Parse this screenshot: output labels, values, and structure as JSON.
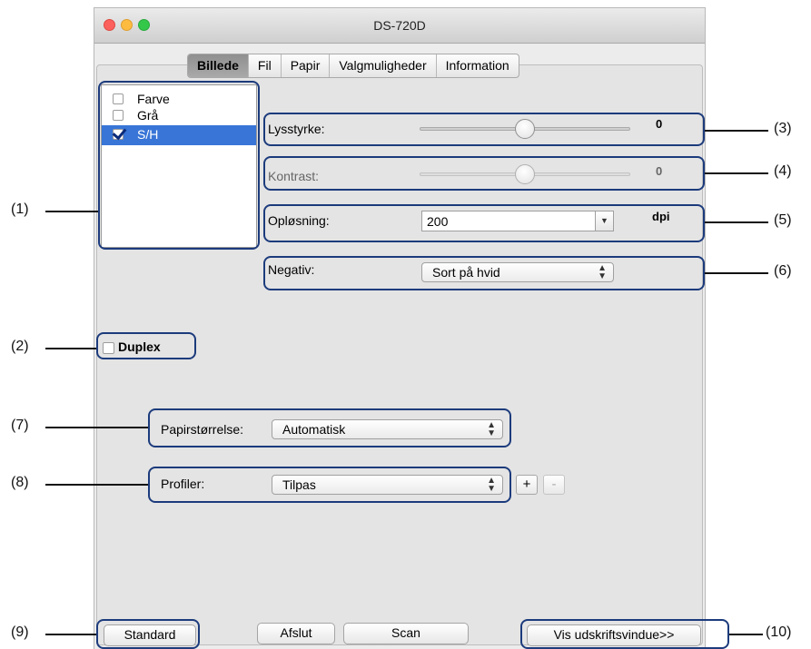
{
  "window": {
    "title": "DS-720D"
  },
  "tabs": [
    {
      "label": "Billede",
      "active": true
    },
    {
      "label": "Fil",
      "active": false
    },
    {
      "label": "Papir",
      "active": false
    },
    {
      "label": "Valgmuligheder",
      "active": false
    },
    {
      "label": "Information",
      "active": false
    }
  ],
  "color_modes": [
    {
      "label": "Farve",
      "checked": false,
      "selected": false
    },
    {
      "label": "Grå",
      "checked": false,
      "selected": false
    },
    {
      "label": "S/H",
      "checked": true,
      "selected": true
    }
  ],
  "brightness": {
    "label": "Lysstyrke:",
    "value": "0",
    "level": 0.5
  },
  "contrast": {
    "label": "Kontrast:",
    "value": "0",
    "level": 0.5,
    "enabled": false
  },
  "resolution": {
    "label": "Opløsning:",
    "value": "200",
    "unit": "dpi"
  },
  "negative": {
    "label": "Negativ:",
    "value": "Sort på hvid"
  },
  "duplex": {
    "label": "Duplex",
    "checked": false
  },
  "paper_size": {
    "label": "Papirstørrelse:",
    "value": "Automatisk"
  },
  "profiles": {
    "label": "Profiler:",
    "value": "Tilpas",
    "add_label": "+",
    "remove_label": "-"
  },
  "buttons": {
    "standard": "Standard",
    "quit": "Afslut",
    "scan": "Scan",
    "preview": "Vis udskriftsvindue>>"
  },
  "callouts": {
    "c1": "(1)",
    "c2": "(2)",
    "c3": "(3)",
    "c4": "(4)",
    "c5": "(5)",
    "c6": "(6)",
    "c7": "(7)",
    "c8": "(8)",
    "c9": "(9)",
    "c10": "(10)"
  },
  "colors": {
    "selection": "#3875d7",
    "callout_border": "#1c3b7c",
    "traffic_red": "#fc605c",
    "traffic_yellow": "#fdbc40",
    "traffic_green": "#34c84a"
  }
}
